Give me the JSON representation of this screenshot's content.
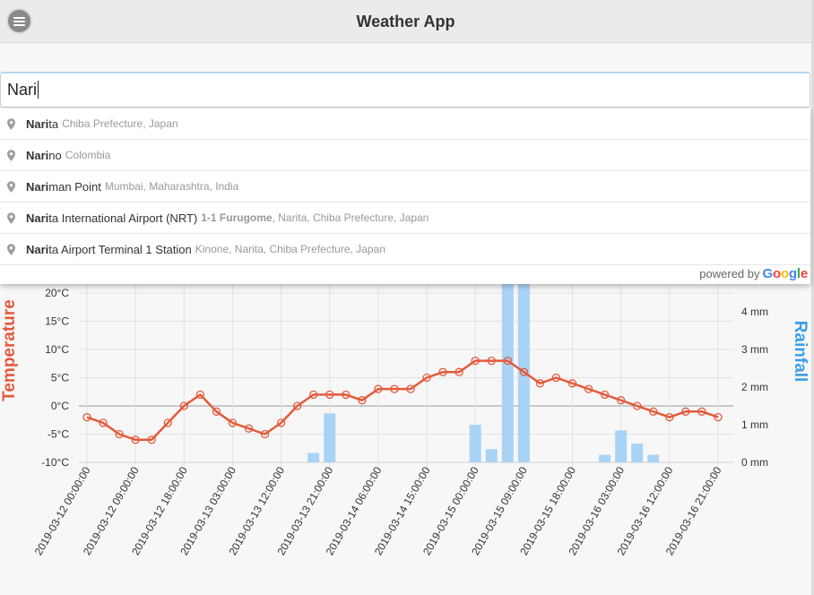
{
  "header": {
    "title": "Weather App",
    "menu_icon": "hamburger-icon"
  },
  "search": {
    "value": "Nari"
  },
  "suggestions": [
    {
      "match": "Nari",
      "rest": "ta",
      "secondary": "Chiba Prefecture, Japan"
    },
    {
      "match": "Nari",
      "rest": "no",
      "secondary": "Colombia"
    },
    {
      "match": "Nari",
      "rest": "man Point",
      "secondary": "Mumbai, Maharashtra, India"
    },
    {
      "match": "Nari",
      "rest": "ta International Airport (NRT)",
      "secondary_bold": "1-1 Furugome",
      "secondary": ", Narita, Chiba Prefecture, Japan"
    },
    {
      "match": "Nari",
      "rest": "ta Airport Terminal 1 Station",
      "secondary": "Kinone, Narita, Chiba Prefecture, Japan"
    }
  ],
  "powered_by": {
    "text": "powered by",
    "brand": "Google"
  },
  "chart_data": {
    "type": "line+bar",
    "y_left_label": "Temperature",
    "y_right_label": "Rainfall",
    "y_left_ticks": [
      "20°C",
      "15°C",
      "10°C",
      "5°C",
      "0°C",
      "-5°C",
      "-10°C"
    ],
    "y_left_range": [
      -10,
      20
    ],
    "y_right_ticks": [
      "4 mm",
      "3 mm",
      "2 mm",
      "1 mm",
      "0 mm"
    ],
    "y_right_range": [
      0,
      4
    ],
    "x_tick_labels": [
      "2019-03-12 00:00:00",
      "2019-03-12 09:00:00",
      "2019-03-12 18:00:00",
      "2019-03-13 03:00:00",
      "2019-03-13 12:00:00",
      "2019-03-13 21:00:00",
      "2019-03-14 06:00:00",
      "2019-03-14 15:00:00",
      "2019-03-15 00:00:00",
      "2019-03-15 09:00:00",
      "2019-03-15 18:00:00",
      "2019-03-16 03:00:00",
      "2019-03-16 12:00:00",
      "2019-03-16 21:00:00"
    ],
    "temperature": [
      -2,
      -3,
      -5,
      -6,
      -6,
      -3,
      0,
      2,
      -1,
      -3,
      -4,
      -5,
      -3,
      0,
      2,
      2,
      2,
      1,
      3,
      3,
      3,
      5,
      6,
      6,
      8,
      8,
      8,
      6,
      4,
      5,
      4,
      3,
      2,
      1,
      0,
      -1,
      -2,
      -1,
      -1,
      -2
    ],
    "rainfall": [
      0,
      0,
      0,
      0,
      0,
      0,
      0,
      0,
      0,
      0,
      0,
      0,
      0,
      0,
      0.25,
      1.3,
      0,
      0,
      0,
      0,
      0,
      0,
      0,
      0,
      1.0,
      0.35,
      5.0,
      5.0,
      0,
      0,
      0,
      0,
      0.2,
      0.85,
      0.5,
      0.2,
      0,
      0,
      0,
      0
    ],
    "colors": {
      "temperature": "#e45a3c",
      "rainfall": "#a9d3f5",
      "left_axis": "#e45a3c",
      "right_axis": "#3a9ee8"
    }
  }
}
